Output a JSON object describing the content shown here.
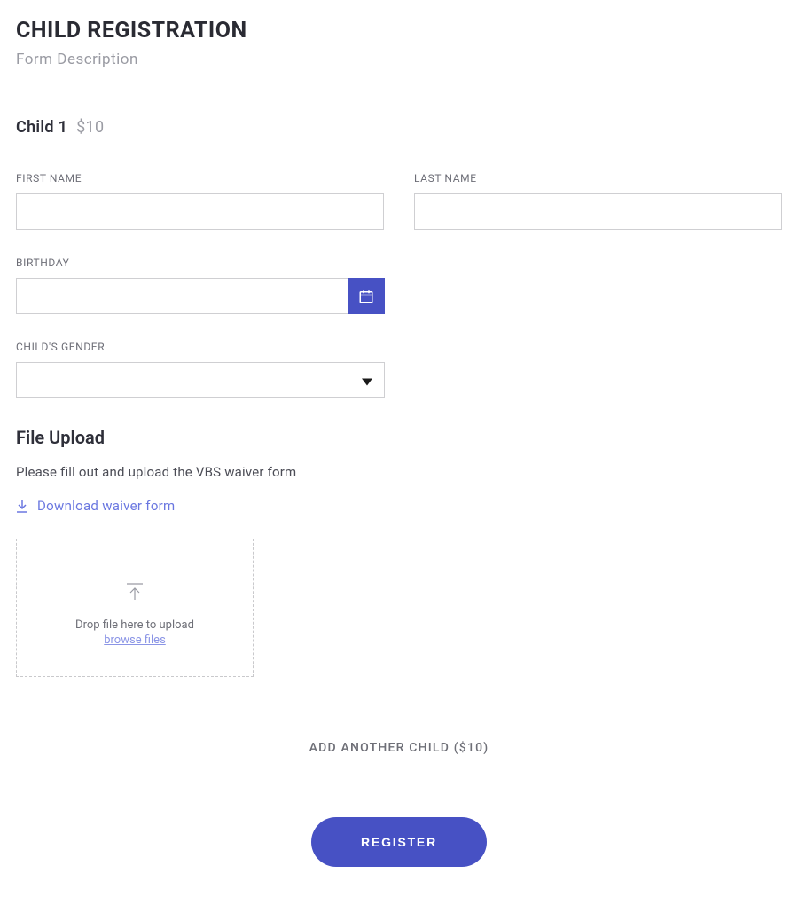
{
  "header": {
    "title": "CHILD REGISTRATION",
    "description": "Form Description"
  },
  "child_section": {
    "label": "Child 1",
    "price": "$10"
  },
  "fields": {
    "first_name": {
      "label": "FIRST NAME",
      "value": ""
    },
    "last_name": {
      "label": "LAST NAME",
      "value": ""
    },
    "birthday": {
      "label": "BIRTHDAY",
      "value": ""
    },
    "gender": {
      "label": "CHILD'S GENDER",
      "value": ""
    }
  },
  "upload": {
    "title": "File Upload",
    "description": "Please fill out and upload the VBS waiver form",
    "download_link": "Download waiver form",
    "dropzone_text": "Drop file here to upload",
    "browse_text": "browse files"
  },
  "add_another": "ADD ANOTHER CHILD ($10)",
  "submit": "REGISTER"
}
